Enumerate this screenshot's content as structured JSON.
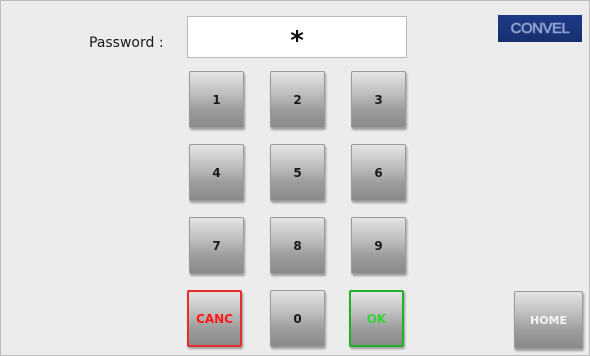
{
  "password": {
    "label": "Password :",
    "value": "*"
  },
  "logo": "CONVEL",
  "keypad": {
    "keys": [
      "1",
      "2",
      "3",
      "4",
      "5",
      "6",
      "7",
      "8",
      "9"
    ],
    "cancel": "CANC",
    "zero": "0",
    "ok": "OK"
  },
  "home": "HOME",
  "colors": {
    "background": "#ebebeb",
    "cancel": "#e52f2f",
    "ok": "#22b02a",
    "logo": "#1d3a88"
  }
}
